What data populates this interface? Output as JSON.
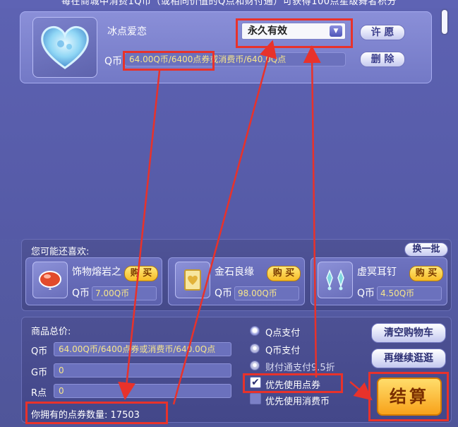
{
  "banner": {
    "text": "每在商城中消费1Q币（或相同价值的Q点和财付通）可获得100点星级舞者积分"
  },
  "cart_item": {
    "name": "冰点爱恋",
    "currency_label": "Q币",
    "price_text": "64.00Q币/6400点券或消费币/640.0Q点",
    "duration_selected": "永久有效",
    "wish_button": "许 愿",
    "delete_button": "删 除"
  },
  "recommend": {
    "title": "您可能还喜欢:",
    "refresh_button": "换一批",
    "items": [
      {
        "name": "饰物熔岩之森",
        "currency_label": "Q币",
        "price": "7.00Q币",
        "buy_label": "购 买"
      },
      {
        "name": "金石良缘",
        "currency_label": "Q币",
        "price": "98.00Q币",
        "buy_label": "购 买"
      },
      {
        "name": "虚冥耳钉",
        "currency_label": "Q币",
        "price": "4.50Q币",
        "buy_label": "购 买"
      }
    ]
  },
  "summary": {
    "title": "商品总价:",
    "rows": [
      {
        "label": "Q币",
        "value": "64.00Q币/6400点券或消费币/640.0Q点"
      },
      {
        "label": "G币",
        "value": "0"
      },
      {
        "label": "R点",
        "value": "0"
      }
    ],
    "owned_points_label": "你拥有的点券数量:",
    "owned_points_value": "17503"
  },
  "payment": {
    "options": [
      {
        "label": "Q点支付",
        "selected": true
      },
      {
        "label": "Q币支付",
        "selected": false
      },
      {
        "label": "财付通支付9.5折",
        "selected": false
      }
    ],
    "checkboxes": [
      {
        "label": "优先使用点券",
        "checked": true
      },
      {
        "label": "优先使用消费币",
        "checked": false
      }
    ]
  },
  "actions": {
    "clear_cart": "清空购物车",
    "continue_shopping": "再继续逛逛",
    "checkout": "结算"
  },
  "colors": {
    "annotation_red": "#e8322b",
    "price_text": "#f6e58b",
    "checkout_gold": "#f8a21a"
  }
}
